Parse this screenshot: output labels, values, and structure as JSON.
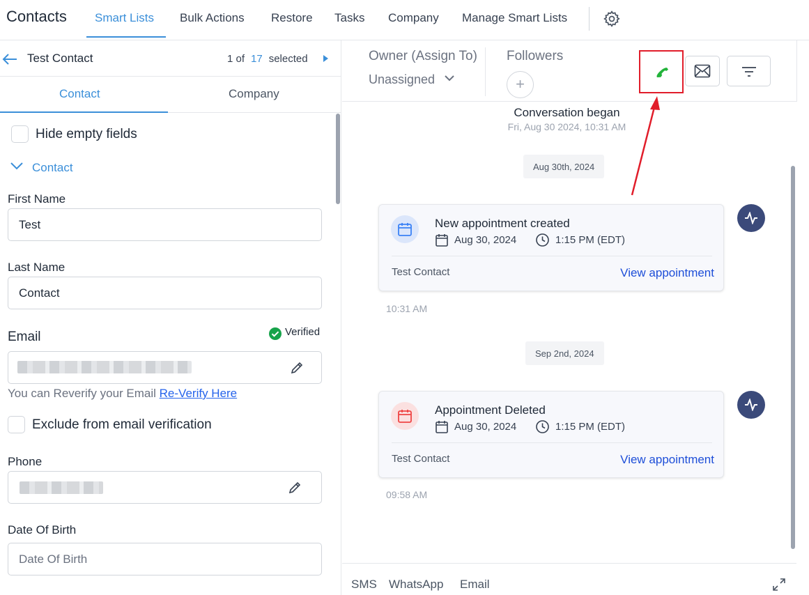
{
  "app": {
    "title": "Contacts",
    "nav": [
      "Smart Lists",
      "Bulk Actions",
      "Restore",
      "Tasks",
      "Company",
      "Manage Smart Lists"
    ],
    "settings_icon": "gear-icon"
  },
  "contact_header": {
    "name": "Test Contact",
    "pager_prefix": "1 of",
    "pager_total": "17",
    "pager_suffix": "selected"
  },
  "subtabs": [
    "Contact",
    "Company"
  ],
  "form": {
    "hide_empty_label": "Hide empty fields",
    "section_label": "Contact",
    "first_name_label": "First Name",
    "first_name_value": "Test",
    "last_name_label": "Last Name",
    "last_name_value": "Contact",
    "email_label": "Email",
    "verified_label": "Verified",
    "reverify_text": "You can Reverify your Email",
    "reverify_link": "Re-Verify Here",
    "exclude_label": "Exclude from email verification",
    "phone_label": "Phone",
    "dob_label": "Date Of Birth",
    "dob_placeholder": "Date Of Birth"
  },
  "conversation": {
    "owner_label": "Owner (Assign To)",
    "owner_value": "Unassigned",
    "followers_label": "Followers",
    "began_title": "Conversation began",
    "began_time": "Fri, Aug 30 2024, 10:31 AM",
    "events": [
      {
        "date_chip": "Aug 30th, 2024",
        "title": "New appointment created",
        "date": "Aug 30, 2024",
        "time": "1:15 PM (EDT)",
        "contact": "Test Contact",
        "link": "View appointment",
        "timestamp": "10:31 AM",
        "color": "#3b82f6"
      },
      {
        "date_chip": "Sep 2nd, 2024",
        "title": "Appointment Deleted",
        "date": "Aug 30, 2024",
        "time": "1:15 PM (EDT)",
        "contact": "Test Contact",
        "link": "View appointment",
        "timestamp": "09:58 AM",
        "color": "#ef4444"
      }
    ],
    "channels": [
      "SMS",
      "WhatsApp",
      "Email"
    ]
  },
  "colors": {
    "accent": "#3b8fd9",
    "highlight": "#e11d2a",
    "call_green": "#22b33a",
    "verified_green": "#16a34a"
  }
}
